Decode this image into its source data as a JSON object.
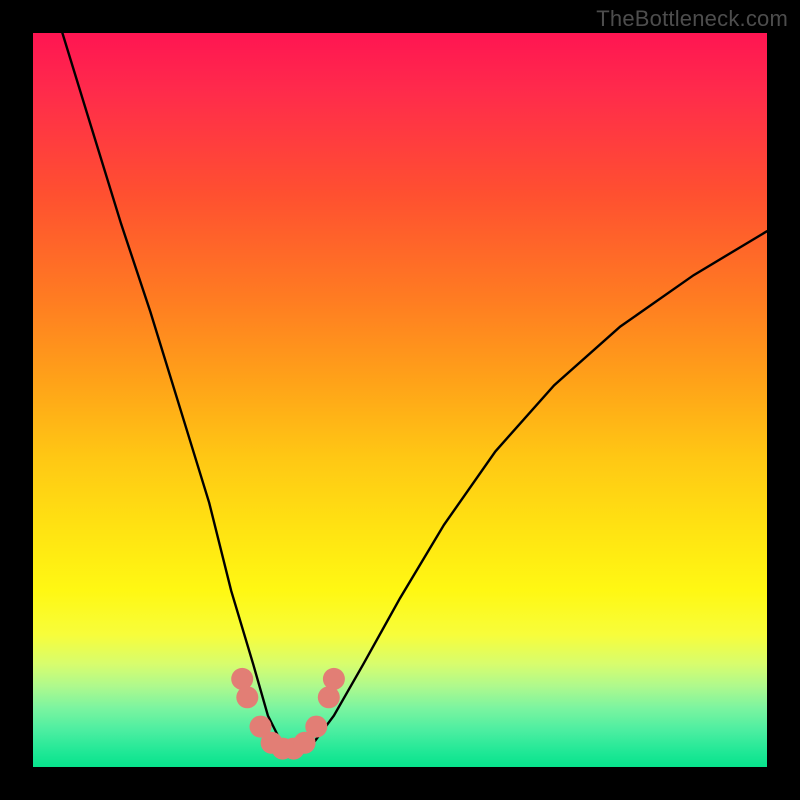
{
  "watermark": "TheBottleneck.com",
  "chart_data": {
    "type": "line",
    "title": "",
    "xlabel": "",
    "ylabel": "",
    "xlim": [
      0,
      100
    ],
    "ylim": [
      0,
      100
    ],
    "series": [
      {
        "name": "bottleneck-curve",
        "x": [
          4,
          8,
          12,
          16,
          20,
          24,
          27,
          30,
          32,
          34,
          36,
          38,
          41,
          45,
          50,
          56,
          63,
          71,
          80,
          90,
          100
        ],
        "values": [
          100,
          87,
          74,
          62,
          49,
          36,
          24,
          14,
          7,
          3,
          2,
          3,
          7,
          14,
          23,
          33,
          43,
          52,
          60,
          67,
          73
        ]
      }
    ],
    "markers": {
      "name": "highlight-dots",
      "color": "#e27e75",
      "points": [
        {
          "x": 28.5,
          "y": 12
        },
        {
          "x": 29.2,
          "y": 9.5
        },
        {
          "x": 31.0,
          "y": 5.5
        },
        {
          "x": 32.5,
          "y": 3.3
        },
        {
          "x": 34.0,
          "y": 2.5
        },
        {
          "x": 35.5,
          "y": 2.5
        },
        {
          "x": 37.0,
          "y": 3.3
        },
        {
          "x": 38.6,
          "y": 5.5
        },
        {
          "x": 40.3,
          "y": 9.5
        },
        {
          "x": 41.0,
          "y": 12
        }
      ]
    },
    "gradient_stops": [
      {
        "pos": 0.0,
        "color": "#ff1552"
      },
      {
        "pos": 0.22,
        "color": "#ff5030"
      },
      {
        "pos": 0.48,
        "color": "#ffa418"
      },
      {
        "pos": 0.76,
        "color": "#fff813"
      },
      {
        "pos": 0.92,
        "color": "#7bf4a0"
      },
      {
        "pos": 1.0,
        "color": "#07e38c"
      }
    ]
  }
}
